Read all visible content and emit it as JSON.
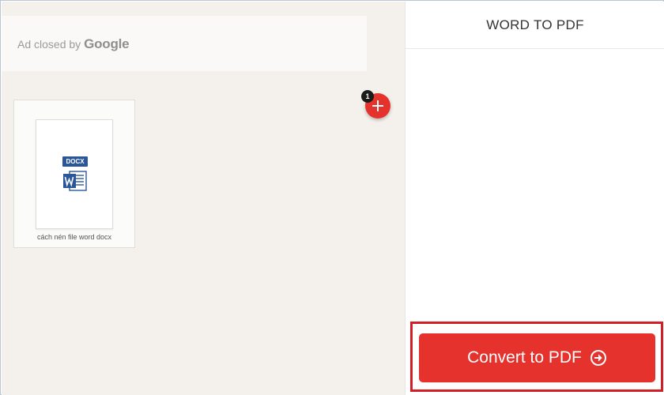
{
  "ad": {
    "prefix": "Ad closed by",
    "brand": "Google"
  },
  "file": {
    "badge": "DOCX",
    "name": "cách nén file word docx"
  },
  "add_files": {
    "count": "1"
  },
  "sidebar": {
    "title": "WORD TO PDF"
  },
  "convert": {
    "label": "Convert to PDF"
  },
  "colors": {
    "accent": "#e5322d",
    "highlight": "#d21f26",
    "word_blue": "#2b579a"
  },
  "icons": {
    "add": "plus-icon",
    "convert": "arrow-right-circle-icon",
    "file": "word-file-icon"
  }
}
